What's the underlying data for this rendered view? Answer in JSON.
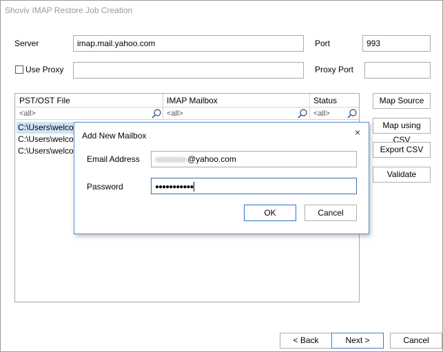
{
  "window": {
    "title": "Shoviv IMAP Restore Job Creation"
  },
  "form": {
    "server_label": "Server",
    "server_value": "imap.mail.yahoo.com",
    "port_label": "Port",
    "port_value": "993",
    "use_proxy_label": "Use Proxy",
    "proxy_value": "",
    "proxy_port_label": "Proxy Port",
    "proxy_port_value": ""
  },
  "grid": {
    "columns": [
      {
        "label": "PST/OST File",
        "filter": "<all>"
      },
      {
        "label": "IMAP Mailbox",
        "filter": "<all>"
      },
      {
        "label": "Status",
        "filter": "<all>"
      }
    ],
    "rows": [
      {
        "file": "C:\\Users\\welcome"
      },
      {
        "file": "C:\\Users\\welcome"
      },
      {
        "file": "C:\\Users\\welcome"
      }
    ]
  },
  "side_buttons": {
    "map_source": "Map Source",
    "map_csv": "Map using CSV",
    "export_csv": "Export CSV",
    "validate": "Validate"
  },
  "nav": {
    "back": "< Back",
    "next": "Next >",
    "cancel": "Cancel"
  },
  "dialog": {
    "title": "Add New Mailbox",
    "close_glyph": "×",
    "email_label": "Email Address",
    "email_domain": "@yahoo.com",
    "password_label": "Password",
    "password_value": "●●●●●●●●●●●",
    "ok": "OK",
    "cancel": "Cancel"
  }
}
